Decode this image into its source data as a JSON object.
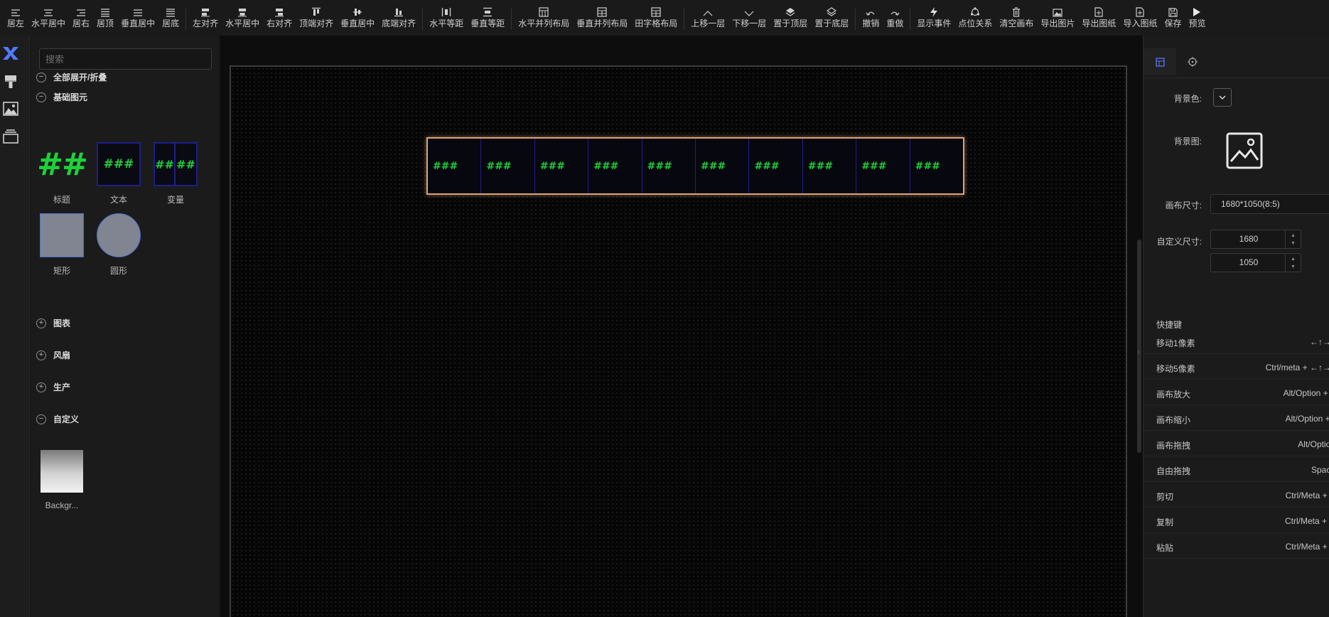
{
  "toolbar": {
    "groups": [
      [
        {
          "icon": "align-left-icon",
          "label": "居左"
        },
        {
          "icon": "align-center-h-icon",
          "label": "水平居中"
        },
        {
          "icon": "align-right-icon",
          "label": "居右"
        },
        {
          "icon": "align-top-icon",
          "label": "居顶"
        },
        {
          "icon": "align-middle-v-icon",
          "label": "垂直居中"
        },
        {
          "icon": "align-bottom-icon",
          "label": "居底"
        }
      ],
      [
        {
          "icon": "left-align-icon",
          "label": "左对齐"
        },
        {
          "icon": "horizontal-center-icon",
          "label": "水平居中"
        },
        {
          "icon": "right-align-icon",
          "label": "右对齐"
        },
        {
          "icon": "top-align-icon",
          "label": "顶端对齐"
        },
        {
          "icon": "vertical-center-icon",
          "label": "垂直居中"
        },
        {
          "icon": "bottom-align-icon",
          "label": "底端对齐"
        }
      ],
      [
        {
          "icon": "horizontal-distribute-icon",
          "label": "水平等距"
        },
        {
          "icon": "vertical-distribute-icon",
          "label": "垂直等距"
        }
      ],
      [
        {
          "icon": "horizontal-layout-icon",
          "label": "水平并列布局"
        },
        {
          "icon": "vertical-layout-icon",
          "label": "垂直并列布局"
        },
        {
          "icon": "grid-layout-icon",
          "label": "田字格布局"
        }
      ],
      [
        {
          "icon": "chevron-up-icon",
          "label": "上移一层"
        },
        {
          "icon": "chevron-down-icon",
          "label": "下移一层"
        },
        {
          "icon": "layer-top-icon",
          "label": "置于顶层"
        },
        {
          "icon": "layer-bottom-icon",
          "label": "置于底层"
        }
      ],
      [
        {
          "icon": "undo-icon",
          "label": "撤销"
        },
        {
          "icon": "redo-icon",
          "label": "重做"
        }
      ],
      [
        {
          "icon": "lightning-icon",
          "label": "显示事件"
        },
        {
          "icon": "relation-icon",
          "label": "点位关系"
        },
        {
          "icon": "trash-icon",
          "label": "清空画布"
        },
        {
          "icon": "image-icon",
          "label": "导出图片"
        },
        {
          "icon": "export-file-icon",
          "label": "导出图纸"
        },
        {
          "icon": "import-file-icon",
          "label": "导入图纸"
        },
        {
          "icon": "save-icon",
          "label": "保存"
        },
        {
          "icon": "play-icon",
          "label": "预览"
        }
      ]
    ]
  },
  "left_strip": [
    "components-icon",
    "paint-brush-icon",
    "image-icon",
    "layers-icon"
  ],
  "left_panel": {
    "search_placeholder": "搜索",
    "expand_all_label": "全部展开/折叠",
    "basic_label": "基础图元",
    "basic_items": [
      {
        "label": "标题",
        "glyph": "##"
      },
      {
        "label": "文本",
        "glyph": "###"
      },
      {
        "label": "变量",
        "glyph": "##"
      },
      {
        "label": "矩形"
      },
      {
        "label": "圆形"
      }
    ],
    "chart_label": "图表",
    "fan_label": "风扇",
    "production_label": "生产",
    "custom_label": "自定义",
    "custom_items": [
      {
        "label": "Backgr..."
      }
    ]
  },
  "canvas": {
    "cell_text": "###",
    "cell_count": 10,
    "selection_color": "#d9a27a",
    "cell_text_color": "#1dd13c"
  },
  "right_panel": {
    "tabs": [
      "grid-tab-icon",
      "target-tab-icon"
    ],
    "bg_color_label": "背景色:",
    "bg_image_label": "背景图:",
    "canvas_size_label": "画布尺寸:",
    "canvas_size_value": "1680*1050(8:5)",
    "custom_size_label": "自定义尺寸:",
    "width": "1680",
    "height": "1050",
    "shortcuts_title": "快捷键",
    "shortcuts": [
      {
        "name": "移动1像素",
        "keys": "←↑→↓"
      },
      {
        "name": "移动5像素",
        "keys": "Ctrl/meta + ←↑→↓"
      },
      {
        "name": "画布放大",
        "keys": "Alt/Option + +"
      },
      {
        "name": "画布缩小",
        "keys": "Alt/Option + -"
      },
      {
        "name": "画布拖拽",
        "keys": "Alt/Option"
      },
      {
        "name": "自由拖拽",
        "keys": "Space"
      },
      {
        "name": "剪切",
        "keys": "Ctrl/Meta + X"
      },
      {
        "name": "复制",
        "keys": "Ctrl/Meta + C"
      },
      {
        "name": "粘贴",
        "keys": "Ctrl/Meta + V"
      }
    ]
  }
}
